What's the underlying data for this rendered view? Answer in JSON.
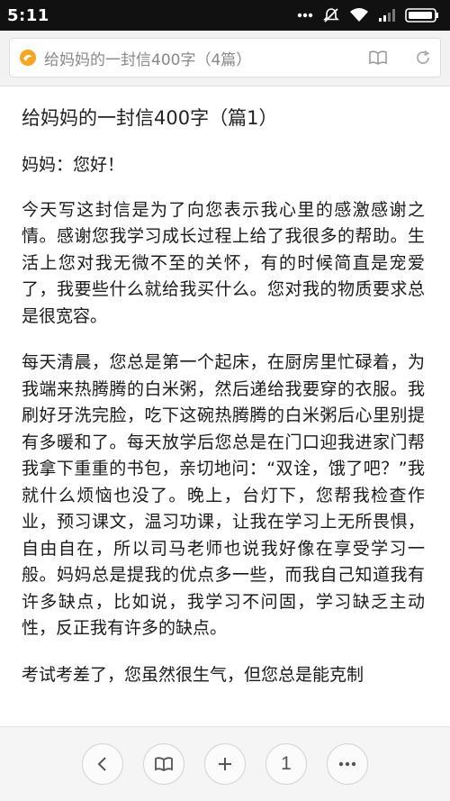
{
  "status_bar": {
    "time": "5:11",
    "icons": [
      "more-dots-icon",
      "mute-icon",
      "wifi-icon",
      "signal-icon",
      "battery-icon"
    ]
  },
  "address_bar": {
    "site_icon": "site-logo-icon",
    "page_title": "给妈妈的一封信400字（4篇）",
    "actions": [
      "reader-mode-icon",
      "refresh-icon"
    ]
  },
  "article": {
    "title": "给妈妈的一封信400字（篇1）",
    "greeting": "妈妈：您好！",
    "paragraphs": [
      "今天写这封信是为了向您表示我心里的感激感谢之情。感谢您我学习成长过程上给了我很多的帮助。生活上您对我无微不至的关怀，有的时候简直是宠爱了，我要些什么就给我买什么。您对我的物质要求总是很宽容。",
      "每天清晨，您总是第一个起床，在厨房里忙碌着，为我端来热腾腾的白米粥，然后递给我要穿的衣服。我刷好牙洗完脸，吃下这碗热腾腾的白米粥后心里别提有多暖和了。每天放学后您总是在门口迎我进家门帮我拿下重重的书包，亲切地问：“双诠，饿了吧？”我就什么烦恼也没了。晚上，台灯下，您帮我检查作业，预习课文，温习功课，让我在学习上无所畏惧，自由自在，所以司马老师也说我好像在享受学习一般。妈妈总是提我的优点多一些，而我自己知道我有许多缺点，比如说，我学习不问固，学习缺乏主动性，反正我有许多的缺点。",
      "考试考差了，您虽然很生气，但您总是能克制"
    ]
  },
  "bottom_toolbar": {
    "back_icon": "back-icon",
    "bookmarks_icon": "bookmarks-icon",
    "add_icon": "add-icon",
    "tab_count": "1",
    "menu_icon": "more-menu-icon"
  }
}
